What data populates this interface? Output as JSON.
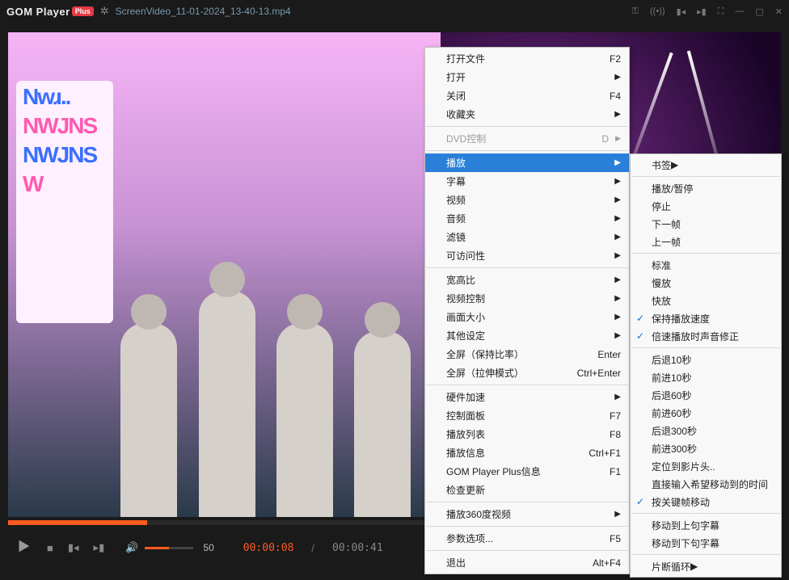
{
  "title": {
    "app": "GOM Player",
    "badge": "Plus",
    "file": "ScreenVideo_11-01-2024_13-40-13.mp4"
  },
  "playback": {
    "volume": "50",
    "current": "00:00:08",
    "duration": "00:00:41"
  },
  "menu": [
    {
      "label": "打开文件",
      "accel": "F2"
    },
    {
      "label": "打开",
      "arrow": true
    },
    {
      "label": "关闭",
      "accel": "F4"
    },
    {
      "label": "收藏夹",
      "arrow": true
    },
    {
      "sep": true
    },
    {
      "label": "DVD控制",
      "accel": "D",
      "arrow": true,
      "disabled": true
    },
    {
      "sep": true
    },
    {
      "label": "播放",
      "arrow": true,
      "hl": true
    },
    {
      "label": "字幕",
      "arrow": true
    },
    {
      "label": "视频",
      "arrow": true
    },
    {
      "label": "音频",
      "arrow": true
    },
    {
      "label": "滤镜",
      "arrow": true
    },
    {
      "label": "可访问性",
      "arrow": true
    },
    {
      "sep": true
    },
    {
      "label": "宽高比",
      "arrow": true
    },
    {
      "label": "视频控制",
      "arrow": true
    },
    {
      "label": "画面大小",
      "arrow": true
    },
    {
      "label": "其他设定",
      "arrow": true
    },
    {
      "label": "全屏（保持比率）",
      "accel": "Enter"
    },
    {
      "label": "全屏（拉伸模式）",
      "accel": "Ctrl+Enter"
    },
    {
      "sep": true
    },
    {
      "label": "硬件加速",
      "arrow": true
    },
    {
      "label": "控制面板",
      "accel": "F7"
    },
    {
      "label": "播放列表",
      "accel": "F8"
    },
    {
      "label": "播放信息",
      "accel": "Ctrl+F1"
    },
    {
      "label": "GOM Player Plus信息",
      "accel": "F1"
    },
    {
      "label": "检查更新"
    },
    {
      "sep": true
    },
    {
      "label": "播放360度视频",
      "arrow": true
    },
    {
      "sep": true
    },
    {
      "label": "参数选项...",
      "accel": "F5"
    },
    {
      "sep": true
    },
    {
      "label": "退出",
      "accel": "Alt+F4"
    }
  ],
  "submenu": [
    {
      "label": "书签",
      "arrow": true
    },
    {
      "sep": true
    },
    {
      "label": "播放/暂停"
    },
    {
      "label": "停止"
    },
    {
      "label": "下一帧"
    },
    {
      "label": "上一帧"
    },
    {
      "sep": true
    },
    {
      "label": "标准"
    },
    {
      "label": "慢放"
    },
    {
      "label": "快放"
    },
    {
      "label": "保持播放速度",
      "check": true
    },
    {
      "label": "倍速播放时声音修正",
      "check": true
    },
    {
      "sep": true
    },
    {
      "label": "后退10秒"
    },
    {
      "label": "前进10秒"
    },
    {
      "label": "后退60秒"
    },
    {
      "label": "前进60秒"
    },
    {
      "label": "后退300秒"
    },
    {
      "label": "前进300秒"
    },
    {
      "label": "定位到影片头.."
    },
    {
      "label": "直接输入希望移动到的时间"
    },
    {
      "label": "按关键帧移动",
      "check": true
    },
    {
      "sep": true
    },
    {
      "label": "移动到上句字幕"
    },
    {
      "label": "移动到下句字幕"
    },
    {
      "sep": true
    },
    {
      "label": "片断循环",
      "arrow": true
    }
  ]
}
